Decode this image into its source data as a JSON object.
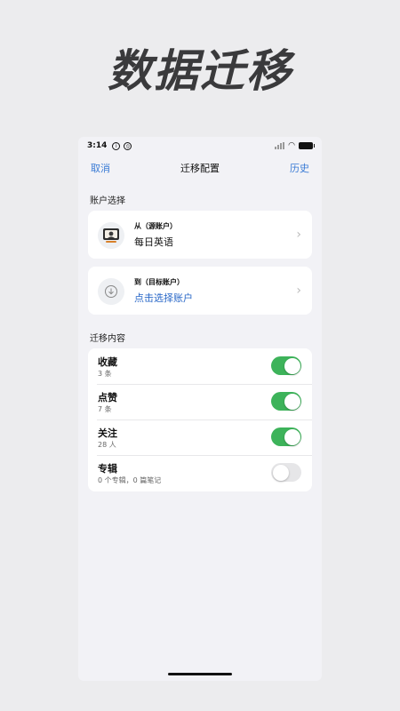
{
  "promo": {
    "title": "数据迁移"
  },
  "status_bar": {
    "time": "3:14"
  },
  "nav": {
    "cancel": "取消",
    "title": "迁移配置",
    "history": "历史"
  },
  "accounts": {
    "header": "账户选择",
    "source": {
      "label": "从（源账户）",
      "value": "每日英语",
      "icon": "avatar-icon"
    },
    "target": {
      "label": "到（目标账户）",
      "value": "点击选择账户",
      "icon": "download-icon"
    }
  },
  "content": {
    "header": "迁移内容",
    "items": [
      {
        "title": "收藏",
        "subtitle": "3 条",
        "enabled": true
      },
      {
        "title": "点赞",
        "subtitle": "7 条",
        "enabled": true
      },
      {
        "title": "关注",
        "subtitle": "28 人",
        "enabled": true
      },
      {
        "title": "专辑",
        "subtitle": "0 个专辑，0 篇笔记",
        "enabled": false
      }
    ]
  },
  "colors": {
    "accent": "#3a7bd5",
    "toggle_on": "#3db35a",
    "background": "#f2f2f6"
  }
}
